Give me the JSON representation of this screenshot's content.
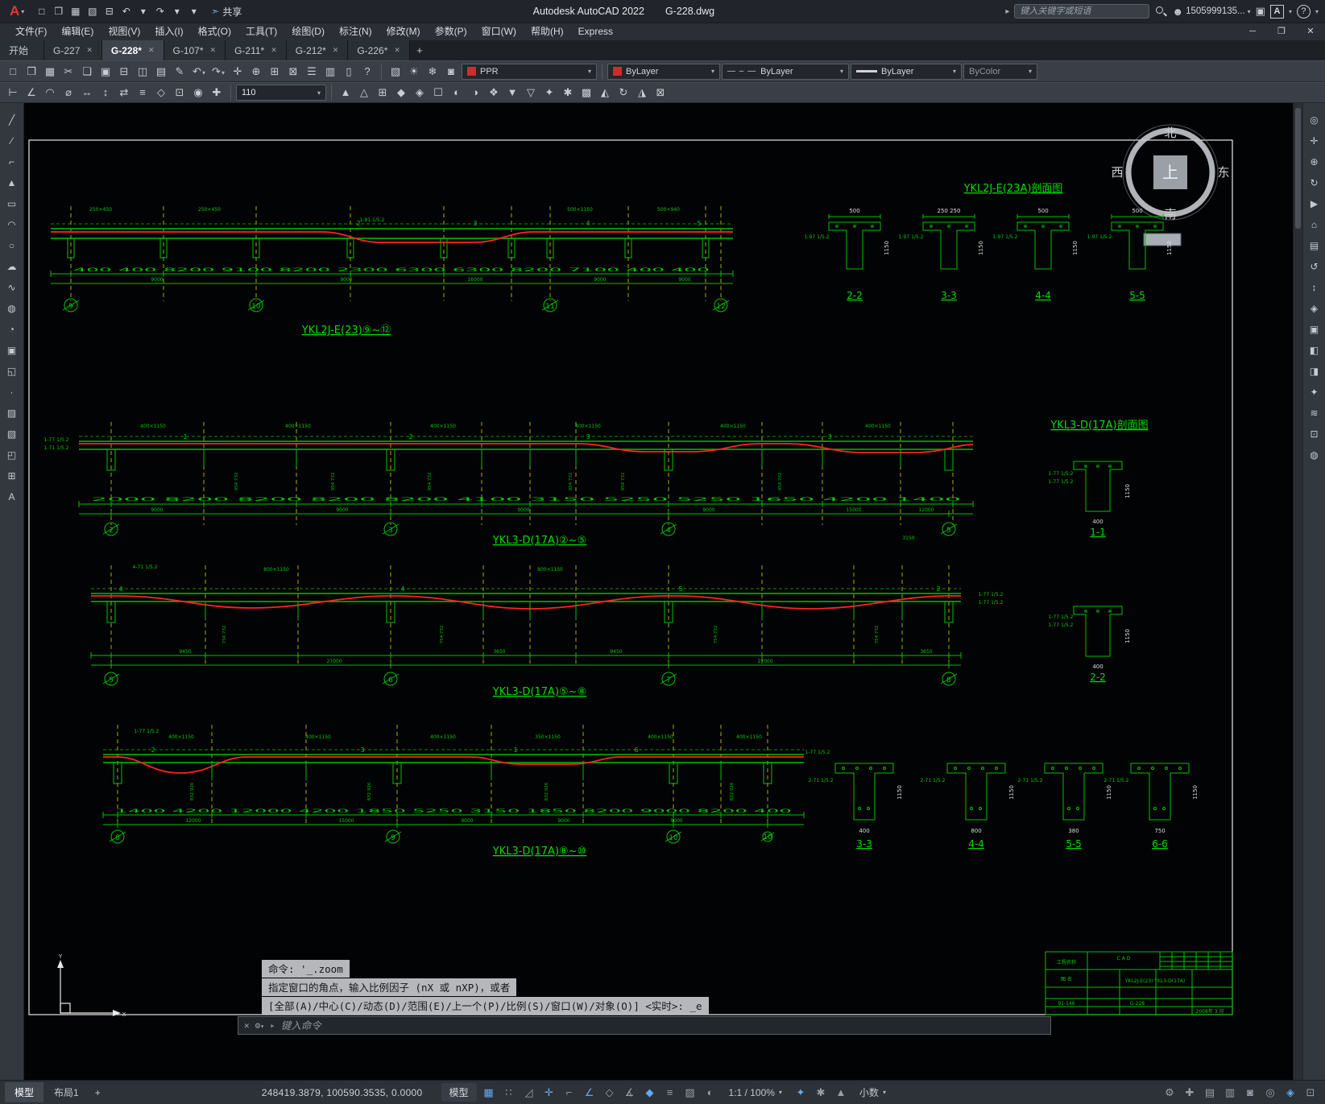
{
  "ui": {
    "caret": "▾"
  },
  "colors": {
    "layer_swatch": "#cf2b2b",
    "color_swatch": "#cf2b2b",
    "drawing_green": "#00c800",
    "drawing_red": "#ff2222",
    "drawing_yellow": "#d6d600",
    "status_on": "#62aaf0"
  },
  "titlebar": {
    "logo_glyph": "A",
    "quick_icons": [
      {
        "name": "new-file-icon",
        "glyph": "□"
      },
      {
        "name": "open-file-icon",
        "glyph": "❐"
      },
      {
        "name": "save-icon",
        "glyph": "▦"
      },
      {
        "name": "save-as-icon",
        "glyph": "▧"
      },
      {
        "name": "plot-icon",
        "glyph": "⊟"
      },
      {
        "name": "undo-icon",
        "glyph": "↶"
      },
      {
        "name": "undo-caret-icon",
        "glyph": "▾"
      },
      {
        "name": "redo-icon",
        "glyph": "↷"
      },
      {
        "name": "redo-caret-icon",
        "glyph": "▾"
      },
      {
        "name": "qat-customize-caret-icon",
        "glyph": "▾"
      }
    ],
    "share_glyph": "➣",
    "share_label": "共享",
    "app_title": "Autodesk AutoCAD 2022",
    "doc_title": "G-228.dwg",
    "collapse_glyph": "▸",
    "search_placeholder": "键入关键字或短语",
    "user_glyph": "☻",
    "account": "1505999135...",
    "cart_glyph": "▣",
    "a_badge": "A",
    "help_glyph": "?"
  },
  "menubar": {
    "items": [
      {
        "name": "menu-file",
        "label": "文件(F)"
      },
      {
        "name": "menu-edit",
        "label": "编辑(E)"
      },
      {
        "name": "menu-view",
        "label": "视图(V)"
      },
      {
        "name": "menu-insert",
        "label": "插入(I)"
      },
      {
        "name": "menu-format",
        "label": "格式(O)"
      },
      {
        "name": "menu-tools",
        "label": "工具(T)"
      },
      {
        "name": "menu-draw",
        "label": "绘图(D)"
      },
      {
        "name": "menu-dimension",
        "label": "标注(N)"
      },
      {
        "name": "menu-modify",
        "label": "修改(M)"
      },
      {
        "name": "menu-parametric",
        "label": "参数(P)"
      },
      {
        "name": "menu-window",
        "label": "窗口(W)"
      },
      {
        "name": "menu-help",
        "label": "帮助(H)"
      },
      {
        "name": "menu-express",
        "label": "Express"
      }
    ],
    "win": {
      "min": "─",
      "max": "❐",
      "close": "✕"
    }
  },
  "tabbar": {
    "tabs": [
      {
        "name": "tab-start",
        "label": "开始",
        "close": "",
        "active": false
      },
      {
        "name": "tab-g-227",
        "label": "G-227",
        "close": "✕",
        "active": false
      },
      {
        "name": "tab-g-228",
        "label": "G-228*",
        "close": "✕",
        "active": true
      },
      {
        "name": "tab-g-107",
        "label": "G-107*",
        "close": "✕",
        "active": false
      },
      {
        "name": "tab-g-211",
        "label": "G-211*",
        "close": "✕",
        "active": false
      },
      {
        "name": "tab-g-212",
        "label": "G-212*",
        "close": "✕",
        "active": false
      },
      {
        "name": "tab-g-226",
        "label": "G-226*",
        "close": "✕",
        "active": false
      }
    ],
    "new_tab_glyph": "+"
  },
  "toolbar1": {
    "icons_a": [
      {
        "name": "qnew-icon",
        "glyph": "□"
      },
      {
        "name": "open-icon",
        "glyph": "❐"
      },
      {
        "name": "qsave-icon",
        "glyph": "▦"
      },
      {
        "name": "cut-icon",
        "glyph": "✂"
      },
      {
        "name": "copy-icon",
        "glyph": "❏"
      },
      {
        "name": "paste-icon",
        "glyph": "▣"
      },
      {
        "name": "plot-icon",
        "glyph": "⊟"
      },
      {
        "name": "plot-preview-icon",
        "glyph": "◫"
      },
      {
        "name": "publish-icon",
        "glyph": "▤"
      },
      {
        "name": "match-properties-icon",
        "glyph": "✎"
      }
    ],
    "undo_glyph": "↶",
    "redo_glyph": "↷",
    "icons_b": [
      {
        "name": "pan-icon",
        "glyph": "✛"
      },
      {
        "name": "zoom-realtime-icon",
        "glyph": "⊕"
      },
      {
        "name": "zoom-window-icon",
        "glyph": "⊞"
      },
      {
        "name": "zoom-previous-icon",
        "glyph": "⊠"
      },
      {
        "name": "properties-icon",
        "glyph": "☰"
      },
      {
        "name": "designcenter-icon",
        "glyph": "▥"
      },
      {
        "name": "tool-palettes-icon",
        "glyph": "▯"
      },
      {
        "name": "help-icon",
        "glyph": "?"
      }
    ],
    "layer_tools": [
      {
        "name": "layer-properties-icon",
        "glyph": "▧"
      },
      {
        "name": "layer-on-icon",
        "glyph": "☀"
      },
      {
        "name": "layer-freeze-icon",
        "glyph": "❄"
      },
      {
        "name": "layer-lock-icon",
        "glyph": "◙"
      }
    ],
    "layer_label": "PPR",
    "color_label": "ByLayer",
    "linetype_sample": "— – —",
    "linetype_label": "ByLayer",
    "lineweight_label": "ByLayer",
    "plotstyle_label": "ByColor"
  },
  "toolbar2": {
    "icons_a": [
      {
        "name": "dim-linear-icon",
        "glyph": "⊢"
      },
      {
        "name": "dim-aligned-icon",
        "glyph": "∠"
      },
      {
        "name": "dim-arc-icon",
        "glyph": "◠"
      },
      {
        "name": "dim-diameter-icon",
        "glyph": "⌀"
      },
      {
        "name": "dim-horizontal-icon",
        "glyph": "↔"
      },
      {
        "name": "dim-vertical-icon",
        "glyph": "↕"
      },
      {
        "name": "dim-continue-icon",
        "glyph": "⇄"
      },
      {
        "name": "dim-baseline-icon",
        "glyph": "≡"
      },
      {
        "name": "mleader-icon",
        "glyph": "◇"
      },
      {
        "name": "tolerance-icon",
        "glyph": "⊡"
      },
      {
        "name": "center-mark-icon",
        "glyph": "◉"
      },
      {
        "name": "dim-edit-icon",
        "glyph": "✚"
      }
    ],
    "size_value": "110",
    "icons_b": [
      {
        "name": "text-style-icon",
        "glyph": "▲"
      },
      {
        "name": "dim-style-icon",
        "glyph": "△"
      },
      {
        "name": "table-style-icon",
        "glyph": "⊞"
      },
      {
        "name": "mleader-style-icon",
        "glyph": "◆"
      },
      {
        "name": "point-style-icon",
        "glyph": "◈"
      },
      {
        "name": "region-icon",
        "glyph": "☐"
      },
      {
        "name": "boundary-icon",
        "glyph": "◐"
      },
      {
        "name": "wipeout-icon",
        "glyph": "◑"
      },
      {
        "name": "object-snap-icon",
        "glyph": "❖"
      },
      {
        "name": "group-icon",
        "glyph": "▼"
      },
      {
        "name": "ungroup-icon",
        "glyph": "▽"
      },
      {
        "name": "measure-icon",
        "glyph": "✦"
      },
      {
        "name": "divide-icon",
        "glyph": "✱"
      },
      {
        "name": "array-icon",
        "glyph": "▩"
      },
      {
        "name": "mirror-icon",
        "glyph": "◭"
      },
      {
        "name": "rotate-icon",
        "glyph": "↻"
      },
      {
        "name": "scale-icon",
        "glyph": "◮"
      },
      {
        "name": "trim-icon",
        "glyph": "⊠"
      }
    ]
  },
  "left_palette": {
    "icons": [
      {
        "name": "line-tool-icon",
        "glyph": "╱"
      },
      {
        "name": "construction-line-tool-icon",
        "glyph": "∕"
      },
      {
        "name": "polyline-tool-icon",
        "glyph": "⌐"
      },
      {
        "name": "polygon-tool-icon",
        "glyph": "▲"
      },
      {
        "name": "rectangle-tool-icon",
        "glyph": "▭"
      },
      {
        "name": "arc-tool-icon",
        "glyph": "◠"
      },
      {
        "name": "circle-tool-icon",
        "glyph": "○"
      },
      {
        "name": "revision-cloud-tool-icon",
        "glyph": "☁"
      },
      {
        "name": "spline-tool-icon",
        "glyph": "∿"
      },
      {
        "name": "ellipse-tool-icon",
        "glyph": "◍"
      },
      {
        "name": "ellipse-arc-tool-icon",
        "glyph": "◔"
      },
      {
        "name": "insert-block-tool-icon",
        "glyph": "▣"
      },
      {
        "name": "make-block-tool-icon",
        "glyph": "◱"
      },
      {
        "name": "point-tool-icon",
        "glyph": "·"
      },
      {
        "name": "hatch-tool-icon",
        "glyph": "▨"
      },
      {
        "name": "gradient-tool-icon",
        "glyph": "▧"
      },
      {
        "name": "region-tool-icon",
        "glyph": "◰"
      },
      {
        "name": "table-tool-icon",
        "glyph": "⊞"
      },
      {
        "name": "mtext-tool-icon",
        "glyph": "A"
      }
    ]
  },
  "right_palette": {
    "icons": [
      {
        "name": "navigation-wheel-icon",
        "glyph": "◎"
      },
      {
        "name": "pan-view-icon",
        "glyph": "✛"
      },
      {
        "name": "zoom-view-icon",
        "glyph": "⊕"
      },
      {
        "name": "orbit-view-icon",
        "glyph": "↻"
      },
      {
        "name": "showmotion-icon",
        "glyph": "▶"
      },
      {
        "name": "viewcube-home-icon",
        "glyph": "⌂"
      },
      {
        "name": "layers-panel-icon",
        "glyph": "▤"
      },
      {
        "name": "view-back-icon",
        "glyph": "↺"
      },
      {
        "name": "view-scroll-icon",
        "glyph": "↕"
      },
      {
        "name": "materials-icon",
        "glyph": "◈"
      },
      {
        "name": "render-icon",
        "glyph": "▣"
      },
      {
        "name": "section-plane-icon",
        "glyph": "◧"
      },
      {
        "name": "clip-icon",
        "glyph": "◨"
      },
      {
        "name": "visual-styles-icon",
        "glyph": "✦"
      },
      {
        "name": "motion-path-icon",
        "glyph": "≋"
      },
      {
        "name": "fullscreen-icon",
        "glyph": "⊡"
      },
      {
        "name": "dot-tool-icon",
        "glyph": "◍"
      }
    ]
  },
  "drawing": {
    "compass": {
      "n": "北",
      "s": "南",
      "w": "西",
      "e": "东",
      "center": "上"
    },
    "beam1": {
      "title": "YKL2J-E(23)⑨~⑫",
      "sizes": [
        "250×450",
        "250×450",
        "500×1150",
        "500×940"
      ],
      "note": "1-91 1/5.2",
      "dims1": "400 400  8200  9100  8200  2300  6300  6300  8200  7100  400 400",
      "dims2": [
        "9000",
        "9000",
        "16000",
        "9000",
        "9000"
      ],
      "marks": [
        "2",
        "3",
        "4",
        "5"
      ],
      "axes": [
        "9",
        "10",
        "11",
        "12"
      ]
    },
    "sec_top": {
      "title": "YKL2J-E(23A)剖面图",
      "note": "1-97 1/5.2",
      "h": "1150",
      "items": [
        {
          "label": "2-2",
          "dim": "500"
        },
        {
          "label": "3-3",
          "dim": "250 250"
        },
        {
          "label": "4-4",
          "dim": "500"
        },
        {
          "label": "5-5",
          "dim": "500"
        }
      ]
    },
    "beam2": {
      "title": "YKL3-D(17A)②~⑤",
      "sizes": [
        "400×1150",
        "400×1150",
        "400×1150",
        "400×1150",
        "400×1150",
        "400×1150"
      ],
      "note1": "1-77 1/5.2",
      "note2": "1-71 1/5.2",
      "stirrup": "954 732",
      "dims1": "2000  8200  8200  8200  8200  4100  3150  5250  5250  1650  4200  1400",
      "dims2": [
        "9000",
        "9000",
        "9000",
        "9000",
        "15000",
        "12000"
      ],
      "extra_dim": "3150",
      "marks": [
        "1",
        "2",
        "3",
        "3"
      ],
      "axes": [
        "2",
        "3",
        "4",
        "5"
      ]
    },
    "sec_mid": {
      "title": "YKL3-D(17A)剖面图",
      "note": "1-77 1/5.2",
      "h": "1150",
      "items": [
        {
          "label": "1-1",
          "dim": "400"
        },
        {
          "label": "2-2",
          "dim": "400"
        }
      ]
    },
    "beam3": {
      "title": "YKL3-D(17A)⑤~⑧",
      "sizes": [
        "800×1150",
        "800×1150"
      ],
      "note": "4-71 1/5.2",
      "note2": "1-77 1/5.2",
      "stirrup": "754 732",
      "dims2": [
        "9450",
        "27000",
        "3650",
        "9450",
        "27000",
        "3650"
      ],
      "marks": [
        "4",
        "4",
        "5",
        "2"
      ],
      "axes": [
        "5",
        "6",
        "7",
        "8"
      ]
    },
    "beam4": {
      "title": "YKL3-D(17A)⑧~⑩",
      "sizes": [
        "400×1150",
        "400×1150",
        "400×1150",
        "350×1150",
        "400×1150",
        "400×1150"
      ],
      "note": "1-77 1/5.2",
      "stirrup": "832 926",
      "dims1": "1400  4200  12000  4200  1850  5250  3150  1850  8200  9000  8200  400",
      "dims2": [
        "12000",
        "15000",
        "9000",
        "9000",
        "9000"
      ],
      "marks": [
        "2",
        "3",
        "1",
        "6"
      ],
      "axes": [
        "8",
        "9",
        "10",
        "10"
      ]
    },
    "sec_bottom": {
      "note": "2-71 1/5.2",
      "h": "1150",
      "items": [
        {
          "label": "3-3",
          "dim": "400"
        },
        {
          "label": "4-4",
          "dim": "800"
        },
        {
          "label": "5-5",
          "dim": "380"
        },
        {
          "label": "6-6",
          "dim": "750"
        }
      ]
    },
    "ucs": {
      "x": "X",
      "y": "Y"
    },
    "titleblock": {
      "row1": "工程名称",
      "row2": "图  名",
      "content": "YKL2J-E(23)  YKL3-D(17A)",
      "cad": "C A D",
      "num1": "91-146",
      "num2": "G-228",
      "date": "2008年 3 月"
    }
  },
  "cmdline": {
    "rows": [
      "命令: '_.zoom",
      "指定窗口的角点，输入比例因子 (nX 或 nXP)，或者",
      "[全部(A)/中心(C)/动态(D)/范围(E)/上一个(P)/比例(S)/窗口(W)/对象(O)] <实时>: _e"
    ],
    "close_glyph": "✕",
    "tool_glyph": "⚙",
    "arrow": "▸",
    "placeholder": "键入命令"
  },
  "statusbar": {
    "model_tab": "模型",
    "layout_tab": "布局1",
    "new_layout_glyph": "+",
    "coords": "248419.3879, 100590.3535, 0.0000",
    "model_space_label": "模型",
    "icons_a": [
      {
        "name": "grid-icon",
        "glyph": "▦",
        "on": true
      },
      {
        "name": "snap-icon",
        "glyph": "∷",
        "on": false
      },
      {
        "name": "infer-constraints-icon",
        "glyph": "◿",
        "on": false
      },
      {
        "name": "dynamic-input-icon",
        "glyph": "✛",
        "on": true
      },
      {
        "name": "ortho-icon",
        "glyph": "⌐",
        "on": false
      },
      {
        "name": "polar-icon",
        "glyph": "∠",
        "on": true
      },
      {
        "name": "isodraft-icon",
        "glyph": "◇",
        "on": false
      },
      {
        "name": "otrack-icon",
        "glyph": "∡",
        "on": false
      },
      {
        "name": "osnap-icon",
        "glyph": "◆",
        "on": true
      },
      {
        "name": "lineweight-display-icon",
        "glyph": "≡",
        "on": false
      },
      {
        "name": "transparency-icon",
        "glyph": "▨",
        "on": false
      },
      {
        "name": "selection-cycling-icon",
        "glyph": "◐",
        "on": false
      }
    ],
    "scale_label": "1:1 / 100%",
    "icons_b": [
      {
        "name": "annotation-visibility-icon",
        "glyph": "✦",
        "on": true
      },
      {
        "name": "autoscale-icon",
        "glyph": "✱",
        "on": false
      },
      {
        "name": "annotation-scale-sync-icon",
        "glyph": "▲",
        "on": false
      }
    ],
    "units_label": "小数",
    "icons_c": [
      {
        "name": "workspace-switching-icon",
        "glyph": "⚙",
        "on": false
      },
      {
        "name": "annotation-monitor-icon",
        "glyph": "✚",
        "on": false
      },
      {
        "name": "units-icon",
        "glyph": "▤",
        "on": false
      },
      {
        "name": "quick-properties-icon",
        "glyph": "▥",
        "on": false
      },
      {
        "name": "lock-ui-icon",
        "glyph": "◙",
        "on": false
      },
      {
        "name": "object-isolate-icon",
        "glyph": "◎",
        "on": false
      },
      {
        "name": "graphics-performance-icon",
        "glyph": "◈",
        "on": true
      },
      {
        "name": "clean-screen-icon",
        "glyph": "⊡",
        "on": false
      }
    ]
  }
}
